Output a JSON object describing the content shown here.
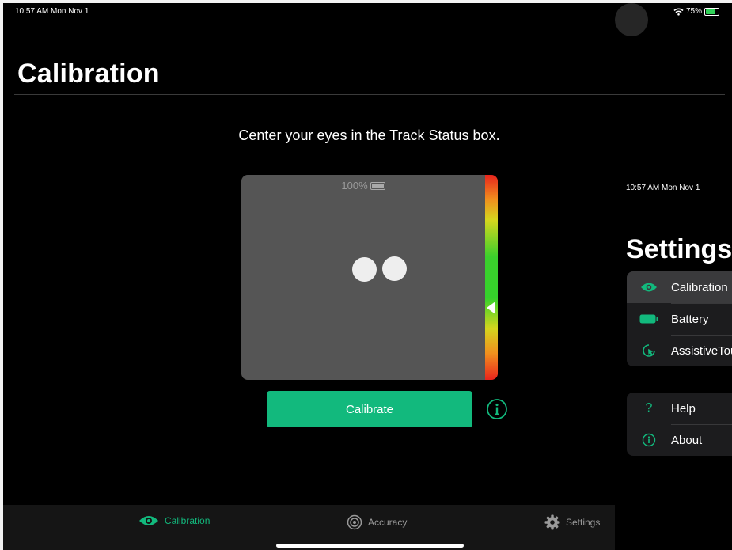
{
  "status_bar": {
    "time": "10:57 AM  Mon Nov 1",
    "battery": "75%"
  },
  "page": {
    "title": "Calibration",
    "instruction": "Center your eyes in the Track Status box."
  },
  "track_box": {
    "battery_label": "100%",
    "eye_count": 2
  },
  "gauge": {
    "marker_level": 0.65
  },
  "calibrate_button": {
    "label": "Calibrate"
  },
  "tabs": [
    {
      "label": "Calibration",
      "icon": "eye-icon",
      "active": true
    },
    {
      "label": "Accuracy",
      "icon": "target-icon",
      "active": false
    },
    {
      "label": "Settings",
      "icon": "gear-icon",
      "active": false
    }
  ],
  "settings_panel": {
    "time": "10:57 AM  Mon Nov 1",
    "title": "Settings",
    "group1": [
      {
        "label": "Calibration",
        "icon": "eye-icon",
        "selected": true
      },
      {
        "label": "Battery",
        "icon": "battery-icon",
        "selected": false
      },
      {
        "label": "AssistiveTouch",
        "icon": "assistive-touch-icon",
        "selected": false
      }
    ],
    "group2": [
      {
        "label": "Help",
        "icon": "question-icon"
      },
      {
        "label": "About",
        "icon": "info-icon"
      }
    ]
  },
  "colors": {
    "accent": "#12b97d",
    "background": "#000000",
    "track_box": "#555555",
    "tab_inactive": "#9a9a9a"
  }
}
